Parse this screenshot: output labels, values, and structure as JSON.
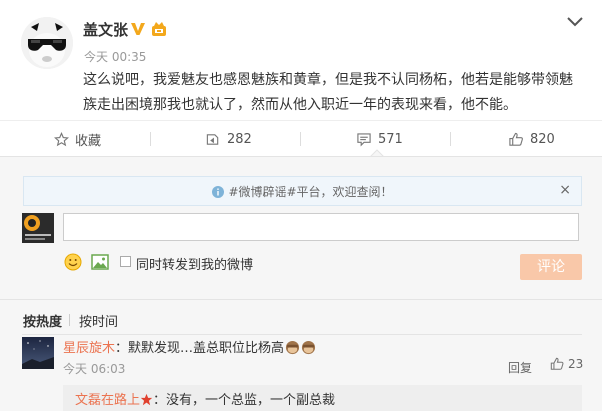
{
  "post": {
    "username": "盖文张",
    "time": "今天 00:35",
    "content": "这么说吧，我爱魅友也感恩魅族和黄章，但是我不认同杨柘，他若是能够带领魅族走出困境那我也就认了，然而从他入职近一年的表现来看，他不能。"
  },
  "actions": {
    "favorite": "收藏",
    "reposts": "282",
    "comments": "571",
    "likes": "820"
  },
  "comment_box": {
    "notice": "#微博辟谣#平台，欢迎查阅！",
    "notice_close": "×",
    "input_value": "",
    "repost_label": "同时转发到我的微博",
    "submit_label": "评论"
  },
  "sort": {
    "hot": "按热度",
    "time": "按时间"
  },
  "comments": [
    {
      "author": "星辰旋木",
      "text": "：默默发现…盖总职位比杨高",
      "time": "今天 06:03",
      "reply_label": "回复",
      "likes": "23",
      "sub_author": "文磊在路上",
      "sub_text": "：没有，一个总监，一个副总裁"
    }
  ],
  "colors": {
    "accent": "#eb7350",
    "verified": "#f3a81c",
    "submit_disabled": "#f9c8a9"
  }
}
